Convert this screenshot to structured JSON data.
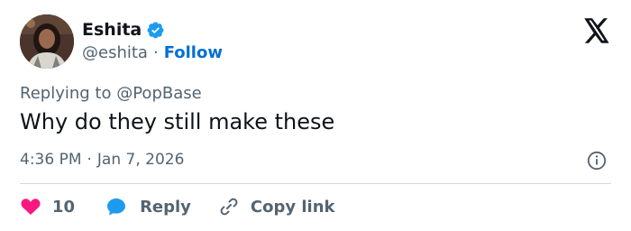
{
  "author": {
    "display_name": "Eshita",
    "handle": "@eshita",
    "separator": "·",
    "follow_label": "Follow",
    "verified": true,
    "avatar_icon": "profile-photo",
    "verified_color": "#1d9bf0"
  },
  "platform_icon": "x-logo-icon",
  "replying": {
    "prefix": "Replying to",
    "mention": "@PopBase"
  },
  "tweet": {
    "text": "Why do they still make these",
    "time": "4:36 PM",
    "separator": "·",
    "date": "Jan 7, 2026"
  },
  "actions": {
    "like_count": "10",
    "reply_label": "Reply",
    "copy_label": "Copy link"
  },
  "colors": {
    "like": "#f91880",
    "reply": "#1d9bf0",
    "link": "#006fd6",
    "muted": "#536471",
    "text": "#0f1419"
  }
}
